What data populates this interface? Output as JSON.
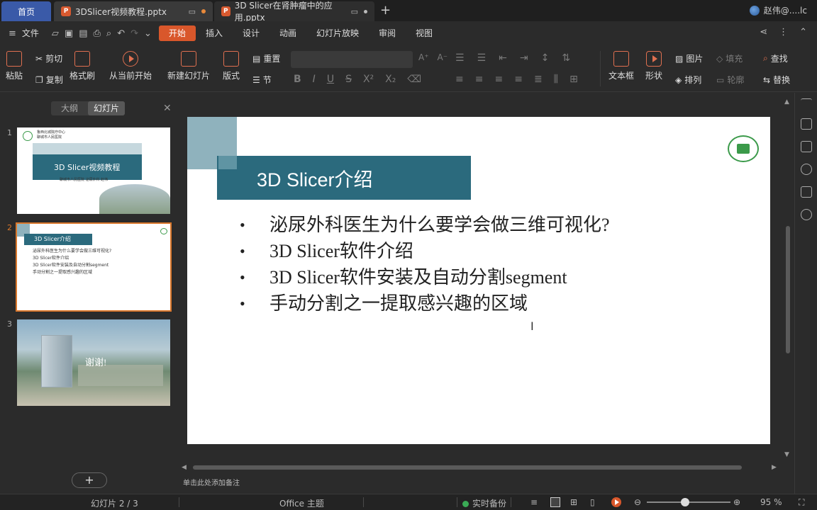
{
  "tabs": {
    "home": "首页",
    "file1": "3DSlicer视频教程.pptx",
    "file2": "3D Slicer在肾肿瘤中的应用.pptx"
  },
  "user": {
    "name": "赵伟@....lc"
  },
  "menu": {
    "file": "文件",
    "items": [
      "开始",
      "插入",
      "设计",
      "动画",
      "幻灯片放映",
      "审阅",
      "视图"
    ]
  },
  "ribbon": {
    "paste": "粘贴",
    "cut": "剪切",
    "copy": "复制",
    "format_painter": "格式刷",
    "play_from_current": "从当前开始",
    "new_slide": "新建幻灯片",
    "layout": "版式",
    "reset": "重置",
    "section": "节",
    "textbox": "文本框",
    "shape": "形状",
    "picture": "图片",
    "fill": "填充",
    "arrange": "排列",
    "outline": "轮廓",
    "find": "查找",
    "replace": "替换"
  },
  "panel": {
    "outline_tab": "大纲",
    "slides_tab": "幻灯片"
  },
  "thumbs": {
    "t1_title": "3D Slicer视频教程",
    "t1_hospital": "聊城市人民医院 泌尿外科 赵伟",
    "t1_logo1": "鲁西北城院疗中心",
    "t1_logo2": "聊城市人民医院",
    "t2_title": "3D Slicer介绍",
    "t3_text": "谢谢!",
    "numbers": [
      "1",
      "2",
      "3"
    ]
  },
  "slide": {
    "title": "3D Slicer介绍",
    "bullets": [
      "泌尿外科医生为什么要学会做三维可视化?",
      "3D Slicer软件介绍",
      "3D Slicer软件安装及自动分割segment",
      "手动分割之一提取感兴趣的区域"
    ]
  },
  "notes_hint": "单击此处添加备注",
  "status": {
    "slide_counter": "幻灯片 2 / 3",
    "theme": "Office 主题",
    "backup": "实时备份",
    "zoom": "95 %"
  }
}
